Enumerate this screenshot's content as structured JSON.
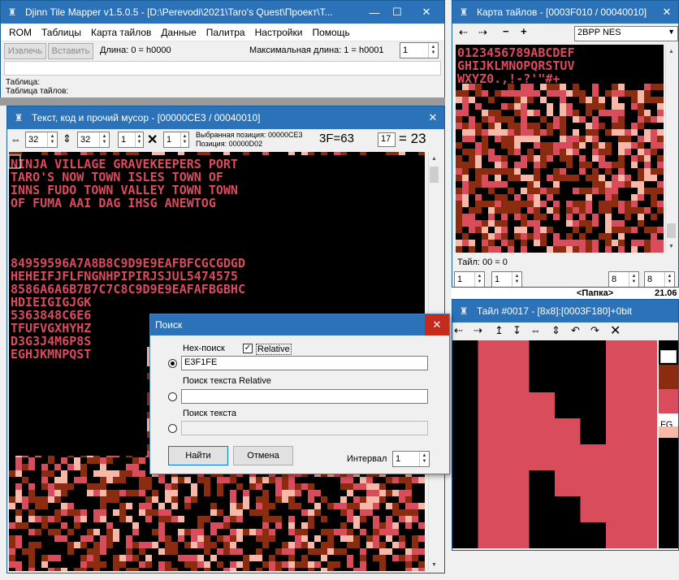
{
  "main": {
    "title": "Djinn Tile Mapper v1.5.0.5 - [D:\\Perevodi\\2021\\Taro's Quest\\Проект\\T...",
    "menu": [
      "ROM",
      "Таблицы",
      "Карта тайлов",
      "Данные",
      "Палитра",
      "Настройки",
      "Помощь"
    ],
    "extract_button": "Извлечь",
    "insert_button": "Вставить",
    "length_label": "Длина: 0 = h0000",
    "max_length_label": "Максимальная длина: 1 = h0001",
    "max_length_value": "1",
    "table_label": "Таблица:",
    "tile_table_label": "Таблица тайлов:"
  },
  "text_window": {
    "title": "Текст, код и прочий мусор - [00000CE3 / 00040010]",
    "width_value": "32",
    "height_value": "32",
    "scale_x": "1",
    "scale_y": "1",
    "multiply_symbol": "✕",
    "selected_position": "Выбранная позиция: 00000CE3",
    "position": "Позиция: 00000D02",
    "hex_readout": "3F=63",
    "value_input": "17",
    "equals_readout": "= 23"
  },
  "tilemap_window": {
    "title": "Карта тайлов - [0003F010 / 00040010]",
    "format_select": "2BPP NES",
    "tile_status": "Тайл: 00 = 0",
    "spin_a": "1",
    "spin_b": "1",
    "spin_c": "8",
    "spin_d": "8",
    "text_lines": [
      "0123456789ABCDEF",
      "GHIJKLMNOPQRSTUV",
      "WXYZ0.,!-?'\"#+"
    ]
  },
  "tile_window": {
    "title": "Тайл #0017 - [8x8]:[0003F180]+0bit",
    "fg_label": "FG",
    "palette_colors": [
      "#ffffff",
      "#8b2c10",
      "#d84c5c",
      "#f8b8a8"
    ]
  },
  "behind_window": {
    "title_fragment": "<Папка>",
    "value_fragment": "21.06"
  },
  "search_dialog": {
    "title": "Поиск",
    "hex_search_label": "Hex-поиск",
    "relative_checkbox_label": "Relative",
    "hex_value": "E3F1FE",
    "text_relative_label": "Поиск текста Relative",
    "text_relative_value": "",
    "text_search_label": "Поиск текста",
    "text_search_value": "",
    "find_button": "Найти",
    "cancel_button": "Отмена",
    "interval_label": "Интервал",
    "interval_value": "1"
  },
  "colors": {
    "titlebar": "#2b72b8",
    "tile_black": "#000000",
    "tile_pink": "#d84c5c",
    "tile_brown": "#8b2c10",
    "tile_light": "#f8b8a8",
    "close_red": "#c42b1c"
  },
  "big_tile": [
    [
      0,
      1,
      1,
      0,
      0,
      0,
      1,
      1
    ],
    [
      0,
      1,
      1,
      0,
      0,
      0,
      1,
      1
    ],
    [
      0,
      1,
      1,
      1,
      0,
      0,
      1,
      1
    ],
    [
      0,
      1,
      1,
      1,
      1,
      0,
      1,
      1
    ],
    [
      0,
      1,
      1,
      1,
      1,
      1,
      1,
      1
    ],
    [
      0,
      1,
      1,
      0,
      1,
      1,
      1,
      1
    ],
    [
      0,
      1,
      1,
      0,
      0,
      1,
      1,
      1
    ],
    [
      0,
      1,
      1,
      0,
      0,
      0,
      1,
      1
    ]
  ],
  "text_rows": [
    "NINJA VILLAGE GRAVEKEEPERS PORT",
    "TARO'S NOW TOWN ISLES TOWN OF",
    "INNS FUDO TOWN VALLEY TOWN TOWN",
    "OF FUMA AAI DAG IHSG ANEWTOG",
    "84959596A7A8B8C9D9E9EAFBFCGCGDGD",
    "HEHEIFJFLFNGNHPIPIRJSJUL5474575",
    "8586A6A6B7B7C7C8C9D9E9EAFAFBGBHC",
    "HDIEIGIGJGK",
    "5363848C6E6",
    "TFUFVGXHYHZ",
    "D3G3J4M6P8S",
    "EGHJKMNPQST"
  ]
}
